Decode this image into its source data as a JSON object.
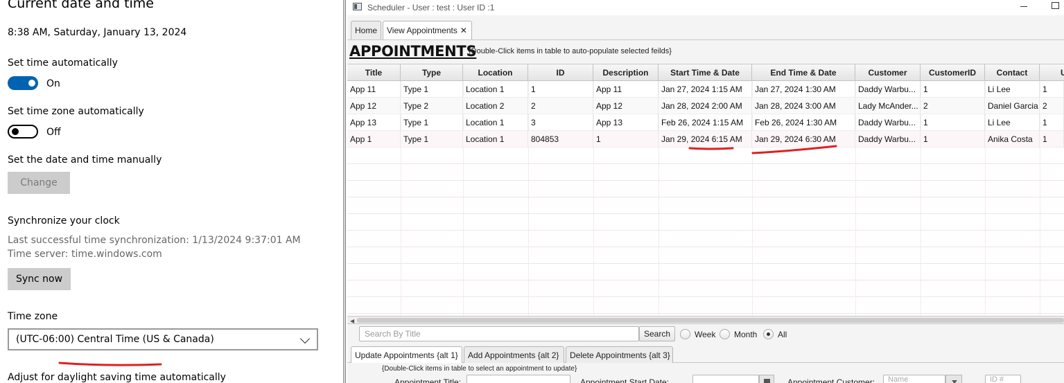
{
  "settings": {
    "heading": "Current date and time",
    "current_datetime": "8:38 AM, Saturday, January 13, 2024",
    "set_time_auto_label": "Set time automatically",
    "set_time_auto_state": "On",
    "set_tz_auto_label": "Set time zone automatically",
    "set_tz_auto_state": "Off",
    "manual_label": "Set the date and time manually",
    "change_button": "Change",
    "sync_heading": "Synchronize your clock",
    "last_sync": "Last successful time synchronization: 1/13/2024 9:37:01 AM",
    "time_server": "Time server: time.windows.com",
    "sync_button": "Sync now",
    "timezone_label": "Time zone",
    "timezone_value": "(UTC-06:00) Central Time (US & Canada)",
    "dst_label": "Adjust for daylight saving time automatically"
  },
  "app": {
    "window_title": "Scheduler - User : test : User ID :1",
    "tabs": [
      {
        "label": "Home"
      },
      {
        "label": "View Appointments",
        "close": "✕"
      }
    ],
    "heading": "APPOINTMENTS",
    "hint": "{Double-Click items in table to auto-populate selected feilds}",
    "table": {
      "columns": [
        "Title",
        "Type",
        "Location",
        "ID",
        "Description",
        "Start Time & Date",
        "End Time & Date",
        "Customer",
        "CustomerID",
        "Contact",
        "U"
      ],
      "rows": [
        [
          "App 11",
          "Type 1",
          "Location 1",
          "1",
          "App 11",
          "Jan 27, 2024 1:15 AM",
          "Jan 27, 2024 1:30 AM",
          "Daddy Warbu...",
          "1",
          "Li Lee",
          "1"
        ],
        [
          "App 12",
          "Type 2",
          "Location 2",
          "2",
          "App 12",
          "Jan 28, 2024 2:00 AM",
          "Jan 28, 2024 3:00 AM",
          "Lady McAnder...",
          "2",
          "Daniel Garcia",
          "2"
        ],
        [
          "App 13",
          "Type 1",
          "Location 1",
          "3",
          "App 13",
          "Feb 26, 2024 1:15 AM",
          "Feb 26, 2024 1:30 AM",
          "Daddy Warbu...",
          "1",
          "Li Lee",
          "1"
        ],
        [
          "App 1",
          "Type 1",
          "Location 1",
          "804853",
          "1",
          "Jan 29, 2024 6:15 AM",
          "Jan 29, 2024 6:30 AM",
          "Daddy Warbu...",
          "1",
          "Anika Costa",
          "1"
        ]
      ]
    },
    "search": {
      "placeholder": "Search By Title",
      "button": "Search",
      "filters": [
        "Week",
        "Month",
        "All"
      ],
      "selected_filter": "All"
    },
    "subtabs": [
      "Update Appointments {alt 1}",
      "Add Appointments {alt 2}",
      "Delete Appointments {alt 3}"
    ],
    "update_hint": "{Double-Click items in table to select an appointment to update}",
    "form": {
      "title_label": "Appointment Title:",
      "start_label": "Appointment Start Date:",
      "customer_label": "Appointment Customer:",
      "customer_placeholder": "Name",
      "id_placeholder": "ID #"
    }
  },
  "annotation_color": "#e02020"
}
